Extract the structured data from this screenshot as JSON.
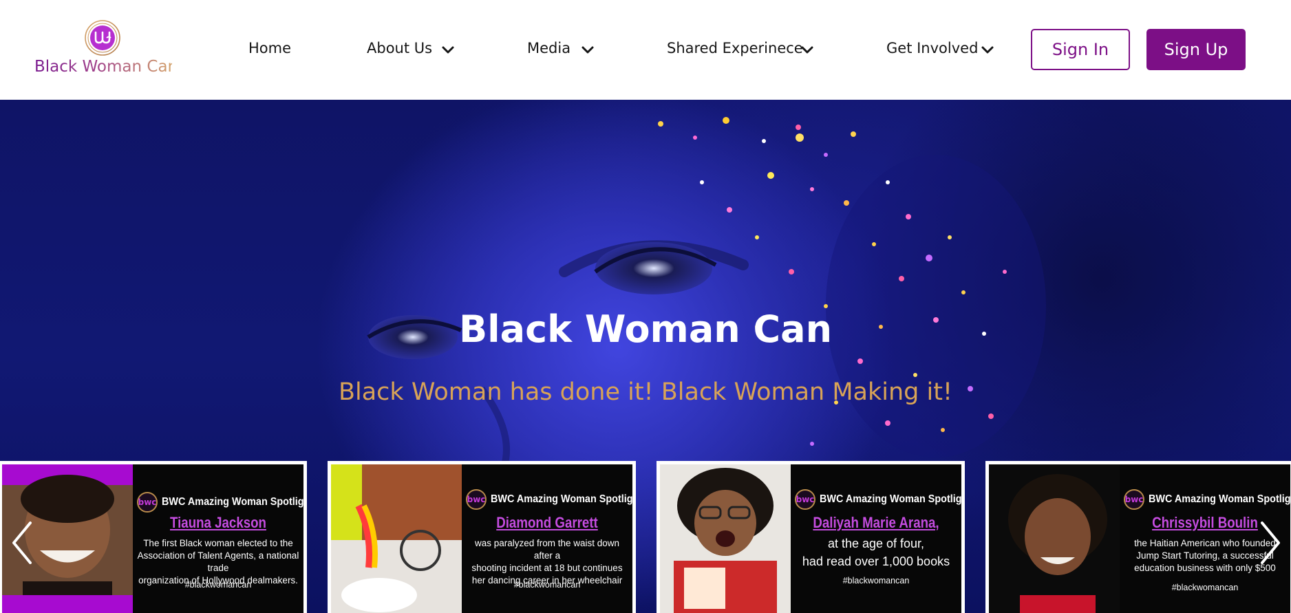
{
  "brand": {
    "name": "Black Woman Can",
    "mark_text": "bwc"
  },
  "nav": {
    "items": [
      {
        "label": "Home",
        "dropdown": false
      },
      {
        "label": "About Us",
        "dropdown": true
      },
      {
        "label": "Media",
        "dropdown": true
      },
      {
        "label": "Shared Experinece",
        "dropdown": true
      },
      {
        "label": "Get Involved",
        "dropdown": true
      }
    ],
    "sign_in": "Sign In",
    "sign_up": "Sign Up"
  },
  "hero": {
    "title": "Black Woman Can",
    "subtitle": "Black Woman has done it! Black Woman Making it!"
  },
  "carousel": {
    "cards": [
      {
        "heading": "BWC Amazing Woman Spotlights",
        "name": "Tiauna Jackson",
        "description": "The first Black woman elected to the\nAssociation of Talent Agents, a national trade\norganization of Hollywood dealmakers.",
        "hashtag": "#blackwomancan"
      },
      {
        "heading": "BWC Amazing Woman Spotlights",
        "name": "Diamond Garrett",
        "description": "was paralyzed from the waist down after a\nshooting incident at 18 but continues\nher dancing career in her wheelchair",
        "hashtag": "#blackwomancan"
      },
      {
        "heading": "BWC Amazing Woman Spotlights",
        "name": "Daliyah Marie Arana,",
        "description": "at the age of four,\nhad read over 1,000 books",
        "hashtag": "#blackwomancan"
      },
      {
        "heading": "BWC Amazing Woman Spotlights",
        "name": "Chrissybil Boulin",
        "description": "the Haitian American who founded\nJump Start Tutoring, a successful\neducation business with only $500",
        "hashtag": "#blackwomancan"
      }
    ]
  },
  "colors": {
    "brand_purple": "#7c0f86",
    "accent_gold": "#d8a357",
    "name_pink": "#c54ce0",
    "hero_blue": "#151a7a"
  },
  "icons": {
    "dropdown": "chevron-down-icon",
    "prev": "chevron-left-icon",
    "next": "chevron-right-icon"
  }
}
